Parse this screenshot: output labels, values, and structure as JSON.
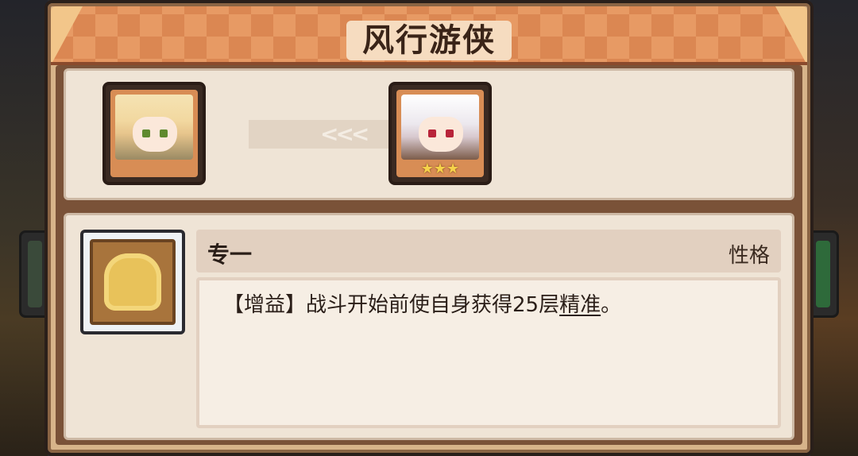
{
  "title": "风行游侠",
  "evolution": {
    "from_character": "portrait-blonde-elf",
    "to_character": "portrait-white-hair-catgirl",
    "arrows": "<<<",
    "to_stars": "★★★"
  },
  "trait": {
    "name": "专一",
    "type_label": "性格",
    "desc_prefix": "【增益】战斗开始前使自身获得25层",
    "desc_keyword": "精准",
    "desc_suffix": "。",
    "icon": "gold-figure-icon"
  },
  "colors": {
    "title_bar": "#e79a64",
    "panel": "#d7b48a",
    "section_bg": "#efe4d6",
    "text": "#2a1e18"
  }
}
